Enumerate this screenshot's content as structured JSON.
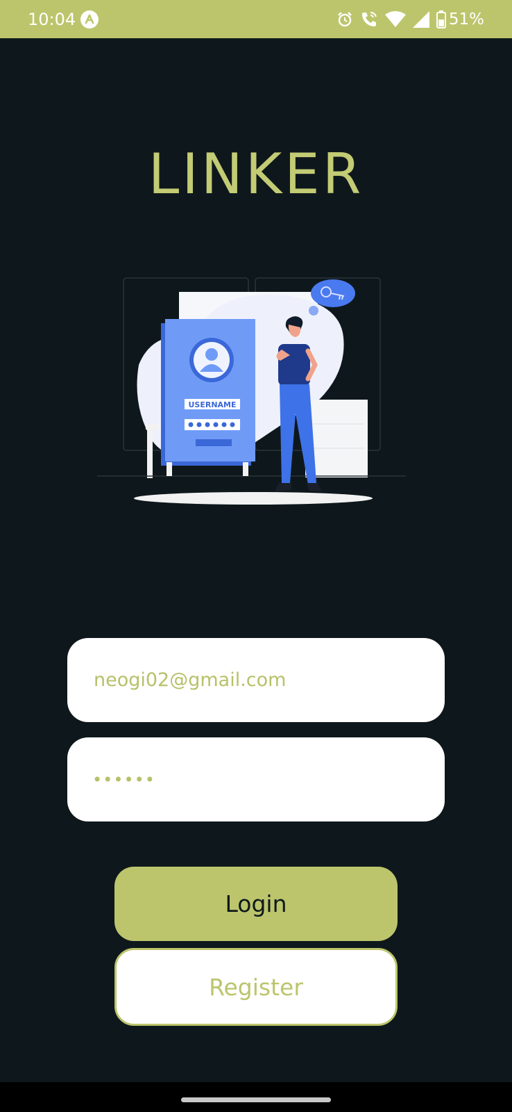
{
  "status_bar": {
    "time": "10:04",
    "battery": "51%",
    "background": "#bcc56b",
    "icons": [
      "app-notification-icon",
      "alarm-icon",
      "wifi-calling-icon",
      "wifi-icon",
      "signal-icon",
      "battery-icon"
    ]
  },
  "app": {
    "title": "LINKER",
    "accent": "#c3cb74",
    "background": "#0e181c"
  },
  "illustration": {
    "card_label": "USERNAME",
    "description_icons": [
      "user-avatar-icon",
      "key-icon"
    ]
  },
  "form": {
    "email": {
      "value": "neogi02@gmail.com"
    },
    "password": {
      "masked_value": "••••••"
    }
  },
  "buttons": {
    "login_label": "Login",
    "register_label": "Register"
  }
}
